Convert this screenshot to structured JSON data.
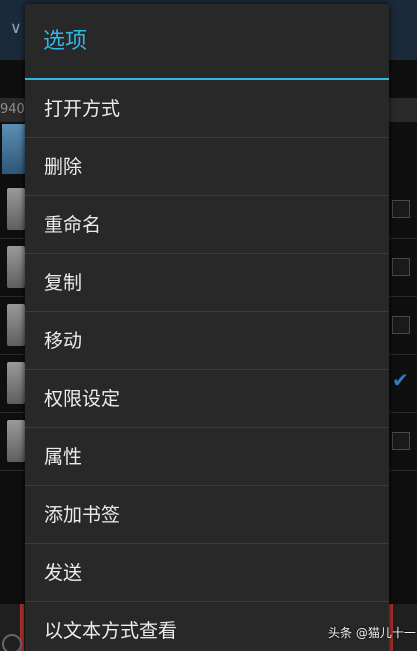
{
  "background": {
    "path_fragment": "940"
  },
  "dialog": {
    "title": "选项",
    "items": [
      {
        "label": "打开方式"
      },
      {
        "label": "删除"
      },
      {
        "label": "重命名"
      },
      {
        "label": "复制"
      },
      {
        "label": "移动"
      },
      {
        "label": "权限设定"
      },
      {
        "label": "属性"
      },
      {
        "label": "添加书签"
      },
      {
        "label": "发送"
      },
      {
        "label": "以文本方式查看"
      }
    ]
  },
  "watermark": "头条 @猫儿十一",
  "colors": {
    "accent": "#33b5e5",
    "dialog_bg": "#282829",
    "text": "#ececec"
  }
}
